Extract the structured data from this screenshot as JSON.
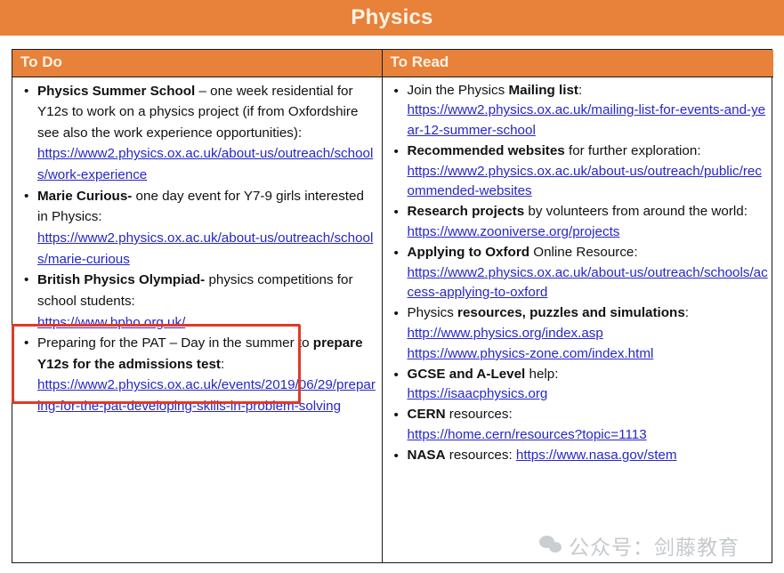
{
  "title": "Physics",
  "watermark": {
    "text": "公众号：剑藤教育",
    "icon": "wechat-icon"
  },
  "colors": {
    "banner_orange": "#E8813A",
    "banner_text": "#FBF3E4",
    "link_blue": "#2726C9",
    "highlight_red": "#E03A26",
    "body_text": "#111111"
  },
  "columns": [
    {
      "header": "To Do"
    },
    {
      "header": "To Read"
    }
  ],
  "todo": {
    "items": [
      {
        "lead_bold": "Physics Summer School",
        "text": " – one week residential for Y12s to work on a physics project (if from Oxfordshire see also the work experience opportunities):",
        "links": [
          "https://www2.physics.ox.ac.uk/about-us/outreach/schools/work-experience"
        ]
      },
      {
        "lead_bold": "Marie Curious-",
        "text": " one day event for Y7-9 girls interested in Physics:",
        "links": [
          "https://www2.physics.ox.ac.uk/about-us/outreach/schools/marie-curious"
        ]
      },
      {
        "lead_bold": "British Physics Olympiad-",
        "text": " physics competitions for school students:",
        "links": [
          "https://www.bpho.org.uk/"
        ],
        "highlighted": true
      },
      {
        "text_before": "Preparing for the PAT – Day in the summer to ",
        "mid_bold": "prepare Y12s for the admissions test",
        "text_after": ":",
        "links": [
          "https://www2.physics.ox.ac.uk/events/2019/06/29/preparing-for-the-pat-developing-skills-in-problem-solving"
        ]
      }
    ]
  },
  "toread": {
    "items": [
      {
        "text_before": "Join the Physics ",
        "mid_bold": "Mailing list",
        "text_after": ":",
        "links": [
          "https://www2.physics.ox.ac.uk/mailing-list-for-events-and-year-12-summer-school"
        ]
      },
      {
        "lead_bold": "Recommended websites",
        "text": " for further exploration:",
        "links": [
          "https://www2.physics.ox.ac.uk/about-us/outreach/public/recommended-websites"
        ]
      },
      {
        "lead_bold": "Research projects",
        "text": " by volunteers from around the world:",
        "links": [
          "https://www.zooniverse.org/projects"
        ]
      },
      {
        "lead_bold": "Applying to Oxford",
        "text": " Online Resource:",
        "links": [
          "https://www2.physics.ox.ac.uk/about-us/outreach/schools/access-applying-to-oxford"
        ]
      },
      {
        "text_before": "Physics ",
        "mid_bold": "resources, puzzles and simulations",
        "text_after": ":",
        "links": [
          "http://www.physics.org/index.asp",
          "https://www.physics-zone.com/index.html"
        ]
      },
      {
        "lead_bold": "GCSE and A-Level",
        "text": " help:",
        "links": [
          "https://isaacphysics.org"
        ]
      },
      {
        "lead_bold": "CERN",
        "text": " resources:",
        "links": [
          "https://home.cern/resources?topic=1113"
        ]
      },
      {
        "lead_bold": "NASA",
        "text": " resources: ",
        "inline_link": "https://www.nasa.gov/stem"
      }
    ]
  }
}
